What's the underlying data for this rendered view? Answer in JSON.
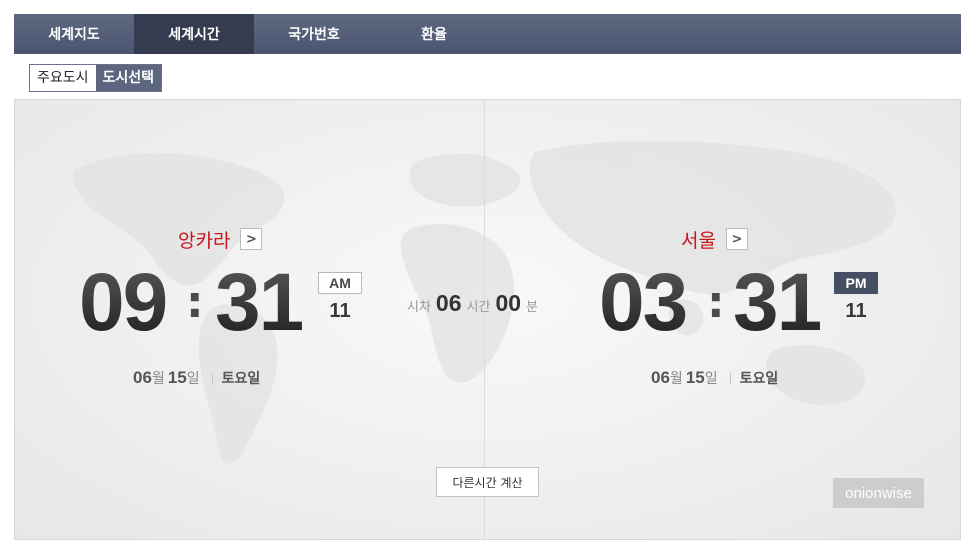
{
  "tabs": [
    {
      "label": "세계지도"
    },
    {
      "label": "세계시간"
    },
    {
      "label": "국가번호"
    },
    {
      "label": "환율"
    }
  ],
  "subtabs": [
    {
      "label": "주요도시"
    },
    {
      "label": "도시선택"
    }
  ],
  "left_city": {
    "name": "앙카라",
    "hour": "09",
    "minute": "31",
    "ampm": "AM",
    "second": "11",
    "month": "06",
    "month_unit": "월",
    "day": "15",
    "day_unit": "일",
    "weekday": "토요일"
  },
  "right_city": {
    "name": "서울",
    "hour": "03",
    "minute": "31",
    "ampm": "PM",
    "second": "11",
    "month": "06",
    "month_unit": "월",
    "day": "15",
    "day_unit": "일",
    "weekday": "토요일"
  },
  "time_diff": {
    "label": "시차",
    "hours": "06",
    "hours_unit": "시간",
    "minutes": "00",
    "minutes_unit": "분"
  },
  "calc_button_label": "다른시간 계산",
  "arrow_glyph": ">",
  "colon_glyph": ":",
  "watermark": "onionwise",
  "colors": {
    "tabbar": "#525b74",
    "active_tab": "#353c50",
    "city_name": "#c8161d",
    "pm_badge": "#474f63"
  }
}
